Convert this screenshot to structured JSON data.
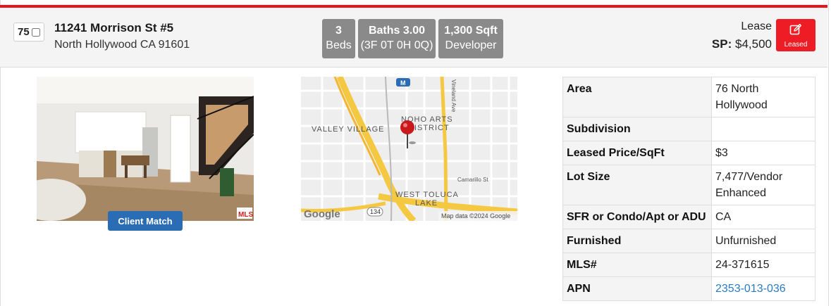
{
  "listing": {
    "index": "75",
    "address_line1": "11241 Morrison St #5",
    "address_line2": "North Hollywood CA 91601",
    "beds_value": "3",
    "beds_label": "Beds",
    "baths_value": "Baths 3.00",
    "baths_detail": "(3F 0T 0H 0Q)",
    "sqft_value": "1,300 Sqft",
    "sqft_source": "Developer",
    "lease_label": "Lease",
    "sp_label": "SP:",
    "sp_value": "$4,500",
    "status_button": "Leased",
    "client_match_button": "Client Match"
  },
  "map": {
    "labels": {
      "valley_village": "VALLEY VILLAGE",
      "noho1": "NOHO ARTS",
      "noho2": "DISTRICT",
      "west_toluca1": "WEST TOLUCA",
      "west_toluca2": "LAKE",
      "camarillo": "Camarillo St",
      "vineland": "Vineland Ave",
      "route": "134",
      "google": "Google",
      "attribution": "Map data ©2024 Google",
      "metro": "M"
    }
  },
  "details": [
    {
      "label": "Area",
      "value": "76 North Hollywood"
    },
    {
      "label": "Subdivision",
      "value": ""
    },
    {
      "label": "Leased Price/SqFt",
      "value": "$3"
    },
    {
      "label": "Lot Size",
      "value": "7,477/Vendor Enhanced"
    },
    {
      "label": "SFR or Condo/Apt or ADU",
      "value": "CA"
    },
    {
      "label": "Furnished",
      "value": "Unfurnished"
    },
    {
      "label": "MLS#",
      "value": "24-371615"
    },
    {
      "label": "APN",
      "value": "2353-013-036"
    }
  ],
  "colors": {
    "accent_red": "#e8141b",
    "button_blue": "#2a6db5",
    "pill_gray": "#8a8a8a",
    "link_blue": "#2a7bc4"
  },
  "icons": {
    "leased": "edit-icon",
    "map_pin": "map-pin-icon",
    "mls_logo": "mls-logo"
  }
}
